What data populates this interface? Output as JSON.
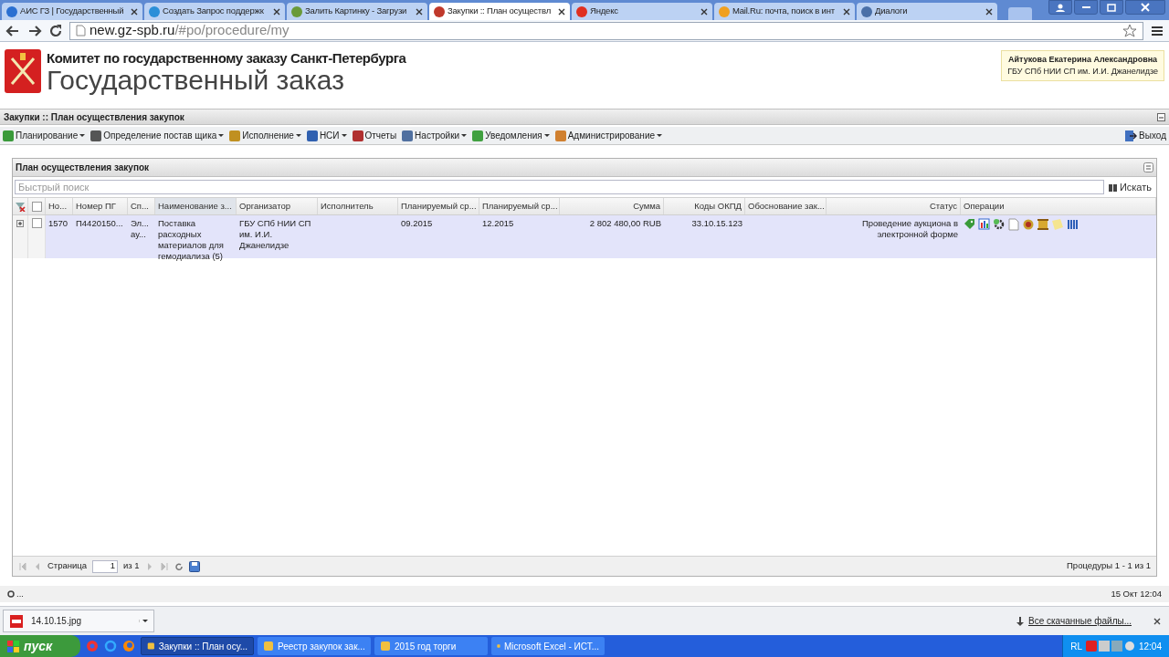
{
  "browser": {
    "tabs": [
      {
        "title": "АИС ГЗ | Государственный",
        "selected": false,
        "color": "#2a6fd1"
      },
      {
        "title": "Создать Запрос поддержк",
        "selected": false,
        "color": "#2b8fd8"
      },
      {
        "title": "Залить Картинку - Загрузи",
        "selected": false,
        "color": "#6a9a3a"
      },
      {
        "title": "Закупки :: План осуществл",
        "selected": true,
        "color": "#c0392b"
      },
      {
        "title": "Яндекс",
        "selected": false,
        "color": "#e03020"
      },
      {
        "title": "Mail.Ru: почта, поиск в инт",
        "selected": false,
        "color": "#f0a020"
      },
      {
        "title": "Диалоги",
        "selected": false,
        "color": "#4a70a8"
      }
    ],
    "url_host": "new.gz-spb.ru",
    "url_path": "/#po/procedure/my"
  },
  "header": {
    "subtitle": "Комитет по государственному заказу Санкт-Петербурга",
    "title": "Государственный заказ",
    "user_name": "Айтукова Екатерина Александровна",
    "user_org": "ГБУ СПб НИИ СП им. И.И. Джанелидзе"
  },
  "page_title": "Закупки :: План осуществления закупок",
  "menu": {
    "items": [
      {
        "label": "Планирование",
        "dropdown": true,
        "color": "#3a9a3a"
      },
      {
        "label": "Определение постав щика",
        "dropdown": true,
        "color": "#555555"
      },
      {
        "label": "Исполнение",
        "dropdown": true,
        "color": "#c09020"
      },
      {
        "label": "НСИ",
        "dropdown": true,
        "color": "#3060b0"
      },
      {
        "label": "Отчеты",
        "dropdown": false,
        "color": "#b03030"
      },
      {
        "label": "Настройки",
        "dropdown": true,
        "color": "#5070a0"
      },
      {
        "label": "Уведомления",
        "dropdown": true,
        "color": "#40a040"
      },
      {
        "label": "Администрирование",
        "dropdown": true,
        "color": "#d08030"
      }
    ],
    "logout": "Выход"
  },
  "panel": {
    "title": "План осуществления закупок",
    "search": {
      "placeholder": "Быстрый поиск",
      "button": "Искать"
    },
    "table": {
      "all_checked": false,
      "columns": [
        {
          "label": "Но...",
          "filtered": false
        },
        {
          "label": "Номер ПГ",
          "filtered": false
        },
        {
          "label": "Сп...",
          "filtered": false
        },
        {
          "label": "Наименование з...",
          "filtered": true
        },
        {
          "label": "Организатор",
          "filtered": false
        },
        {
          "label": "Исполнитель",
          "filtered": false
        },
        {
          "label": "Планируемый ср...",
          "filtered": false
        },
        {
          "label": "Планируемый ср...",
          "filtered": false
        },
        {
          "label": "Сумма",
          "filtered": false
        },
        {
          "label": "Коды ОКПД",
          "filtered": false
        },
        {
          "label": "Обоснование зак...",
          "filtered": false
        },
        {
          "label": "Статус",
          "filtered": false
        },
        {
          "label": "Операции",
          "filtered": false
        }
      ],
      "rows": [
        {
          "checked": false,
          "selected": true,
          "cells": [
            "1570",
            "П4420150...",
            "Эл... ау...",
            "Поставка расходных материалов для гемодиализа (5)",
            "ГБУ СПб НИИ СП им. И.И. Джанелидзе",
            "",
            "09.2015",
            "12.2015",
            "2 802 480,00 RUB",
            "33.10.15.123",
            "",
            "Проведение аукциона в электронной форме"
          ]
        }
      ]
    },
    "pager": {
      "page_label": "Страница",
      "page": "1",
      "of": "из 1",
      "summary": "Процедуры 1 - 1 из 1"
    }
  },
  "status_bar": {
    "left": "...",
    "right": "15 Окт 12:04"
  },
  "downloads": {
    "file": "14.10.15.jpg",
    "all": "Все скачанные файлы..."
  },
  "taskbar": {
    "start": "пуск",
    "items": [
      {
        "title": "Закупки :: План осу...",
        "selected": true
      },
      {
        "title": "Реестр закупок зак...",
        "selected": false
      },
      {
        "title": "2015 год торги",
        "selected": false
      },
      {
        "title": "Microsoft Excel - ИСТ...",
        "selected": false
      }
    ],
    "lang": "RL",
    "time": "12:04"
  }
}
